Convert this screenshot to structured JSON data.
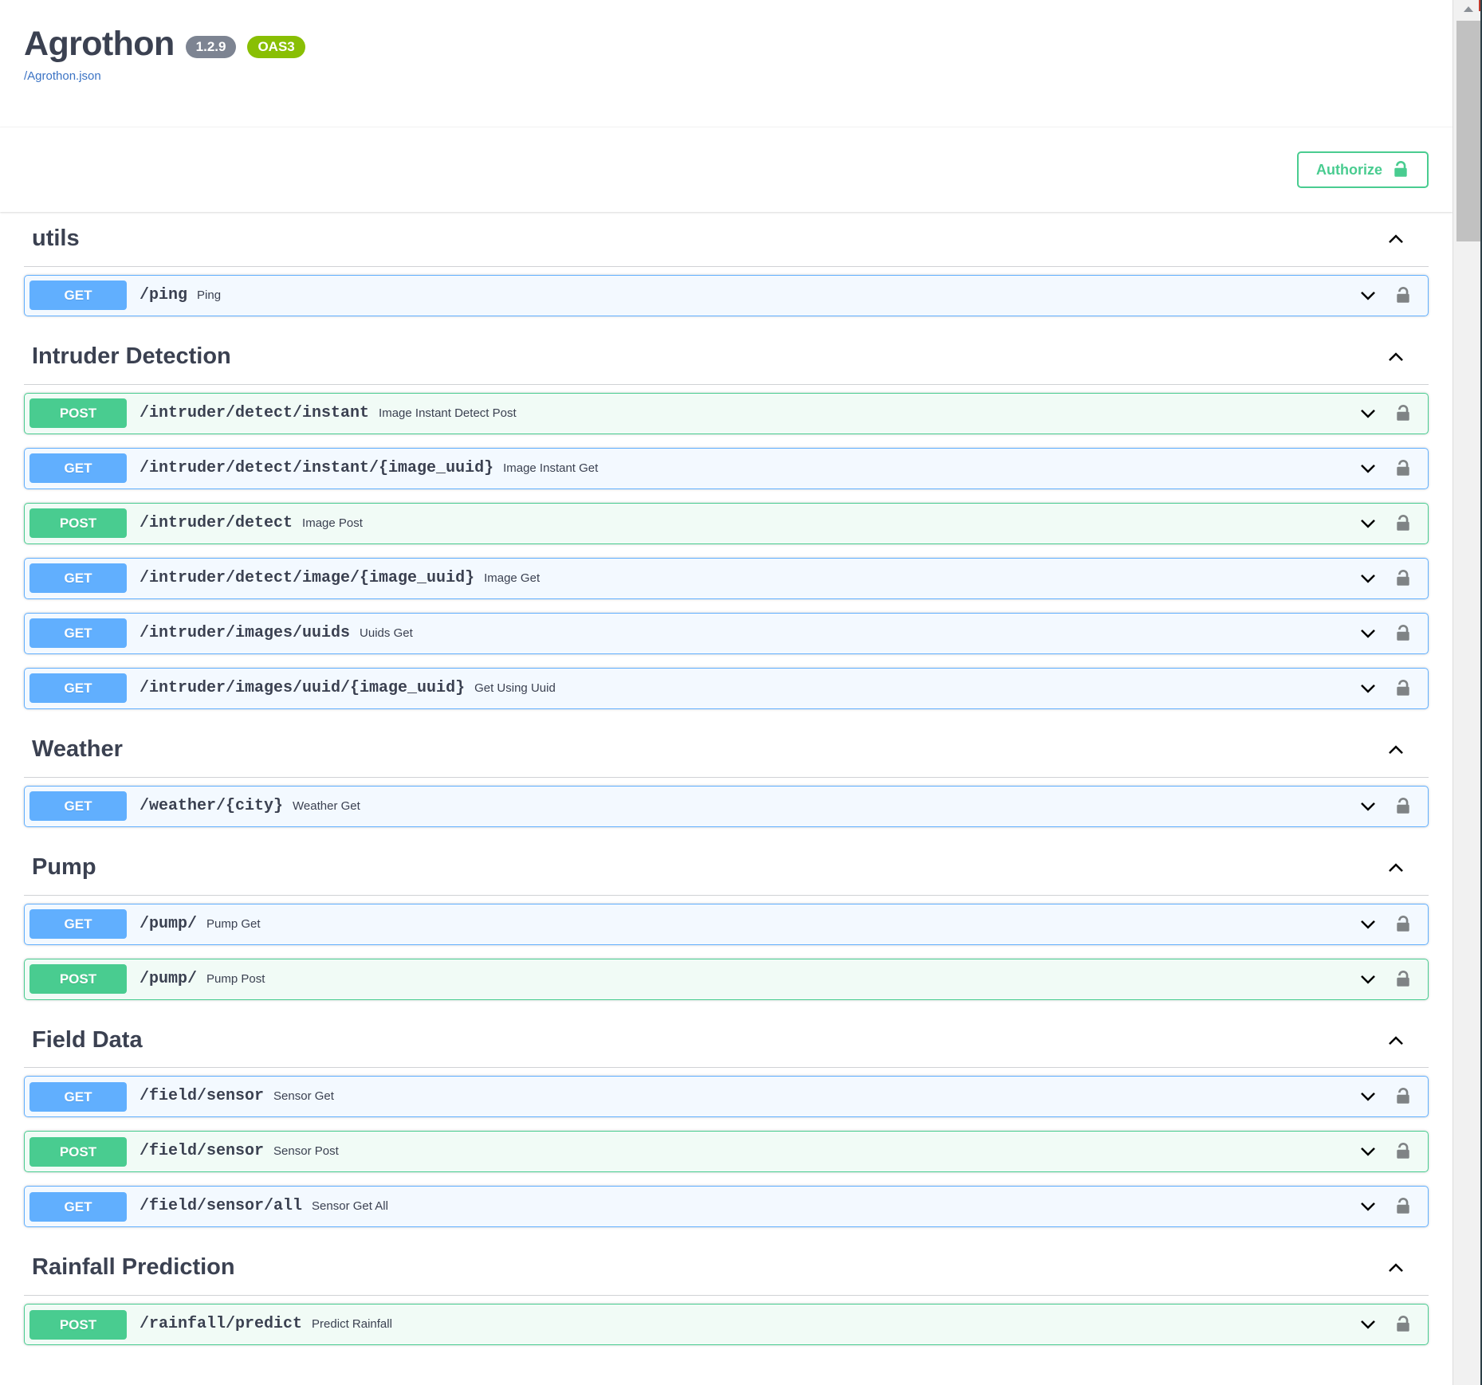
{
  "header": {
    "title": "Agrothon",
    "version_badge": "1.2.9",
    "oas_badge": "OAS3",
    "spec_url": "/Agrothon.json"
  },
  "authorize": {
    "label": "Authorize",
    "icon": "unlock-icon"
  },
  "colors": {
    "get": "#61affe",
    "post": "#49cc90",
    "title": "#3b4151",
    "version_badge": "#7d8492",
    "oas_badge": "#89bf04",
    "link": "#3b73c4"
  },
  "sections": [
    {
      "tag": "utils",
      "expanded": true,
      "toggle_icon": "chevron-up-icon",
      "operations": [
        {
          "method": "GET",
          "path": "/ping",
          "summary": "Ping",
          "expand_icon": "chevron-down-icon",
          "auth_icon": "unlock-icon"
        }
      ]
    },
    {
      "tag": "Intruder Detection",
      "expanded": true,
      "toggle_icon": "chevron-up-icon",
      "operations": [
        {
          "method": "POST",
          "path": "/intruder/detect/instant",
          "summary": "Image Instant Detect Post",
          "expand_icon": "chevron-down-icon",
          "auth_icon": "unlock-icon"
        },
        {
          "method": "GET",
          "path": "/intruder/detect/instant/{image_uuid}",
          "summary": "Image Instant Get",
          "expand_icon": "chevron-down-icon",
          "auth_icon": "unlock-icon"
        },
        {
          "method": "POST",
          "path": "/intruder/detect",
          "summary": "Image Post",
          "expand_icon": "chevron-down-icon",
          "auth_icon": "unlock-icon"
        },
        {
          "method": "GET",
          "path": "/intruder/detect/image/{image_uuid}",
          "summary": "Image Get",
          "expand_icon": "chevron-down-icon",
          "auth_icon": "unlock-icon"
        },
        {
          "method": "GET",
          "path": "/intruder/images/uuids",
          "summary": "Uuids Get",
          "expand_icon": "chevron-down-icon",
          "auth_icon": "unlock-icon"
        },
        {
          "method": "GET",
          "path": "/intruder/images/uuid/{image_uuid}",
          "summary": "Get Using Uuid",
          "expand_icon": "chevron-down-icon",
          "auth_icon": "unlock-icon"
        }
      ]
    },
    {
      "tag": "Weather",
      "expanded": true,
      "toggle_icon": "chevron-up-icon",
      "operations": [
        {
          "method": "GET",
          "path": "/weather/{city}",
          "summary": "Weather Get",
          "expand_icon": "chevron-down-icon",
          "auth_icon": "unlock-icon"
        }
      ]
    },
    {
      "tag": "Pump",
      "expanded": true,
      "toggle_icon": "chevron-up-icon",
      "operations": [
        {
          "method": "GET",
          "path": "/pump/",
          "summary": "Pump Get",
          "expand_icon": "chevron-down-icon",
          "auth_icon": "unlock-icon"
        },
        {
          "method": "POST",
          "path": "/pump/",
          "summary": "Pump Post",
          "expand_icon": "chevron-down-icon",
          "auth_icon": "unlock-icon"
        }
      ]
    },
    {
      "tag": "Field Data",
      "expanded": true,
      "toggle_icon": "chevron-up-icon",
      "operations": [
        {
          "method": "GET",
          "path": "/field/sensor",
          "summary": "Sensor Get",
          "expand_icon": "chevron-down-icon",
          "auth_icon": "unlock-icon"
        },
        {
          "method": "POST",
          "path": "/field/sensor",
          "summary": "Sensor Post",
          "expand_icon": "chevron-down-icon",
          "auth_icon": "unlock-icon"
        },
        {
          "method": "GET",
          "path": "/field/sensor/all",
          "summary": "Sensor Get All",
          "expand_icon": "chevron-down-icon",
          "auth_icon": "unlock-icon"
        }
      ]
    },
    {
      "tag": "Rainfall Prediction",
      "expanded": true,
      "toggle_icon": "chevron-up-icon",
      "operations": [
        {
          "method": "POST",
          "path": "/rainfall/predict",
          "summary": "Predict Rainfall",
          "expand_icon": "chevron-down-icon",
          "auth_icon": "unlock-icon"
        }
      ]
    }
  ],
  "scrollbar": {
    "up_arrow_icon": "triangle-up-icon",
    "thumb": "scroll-thumb"
  }
}
